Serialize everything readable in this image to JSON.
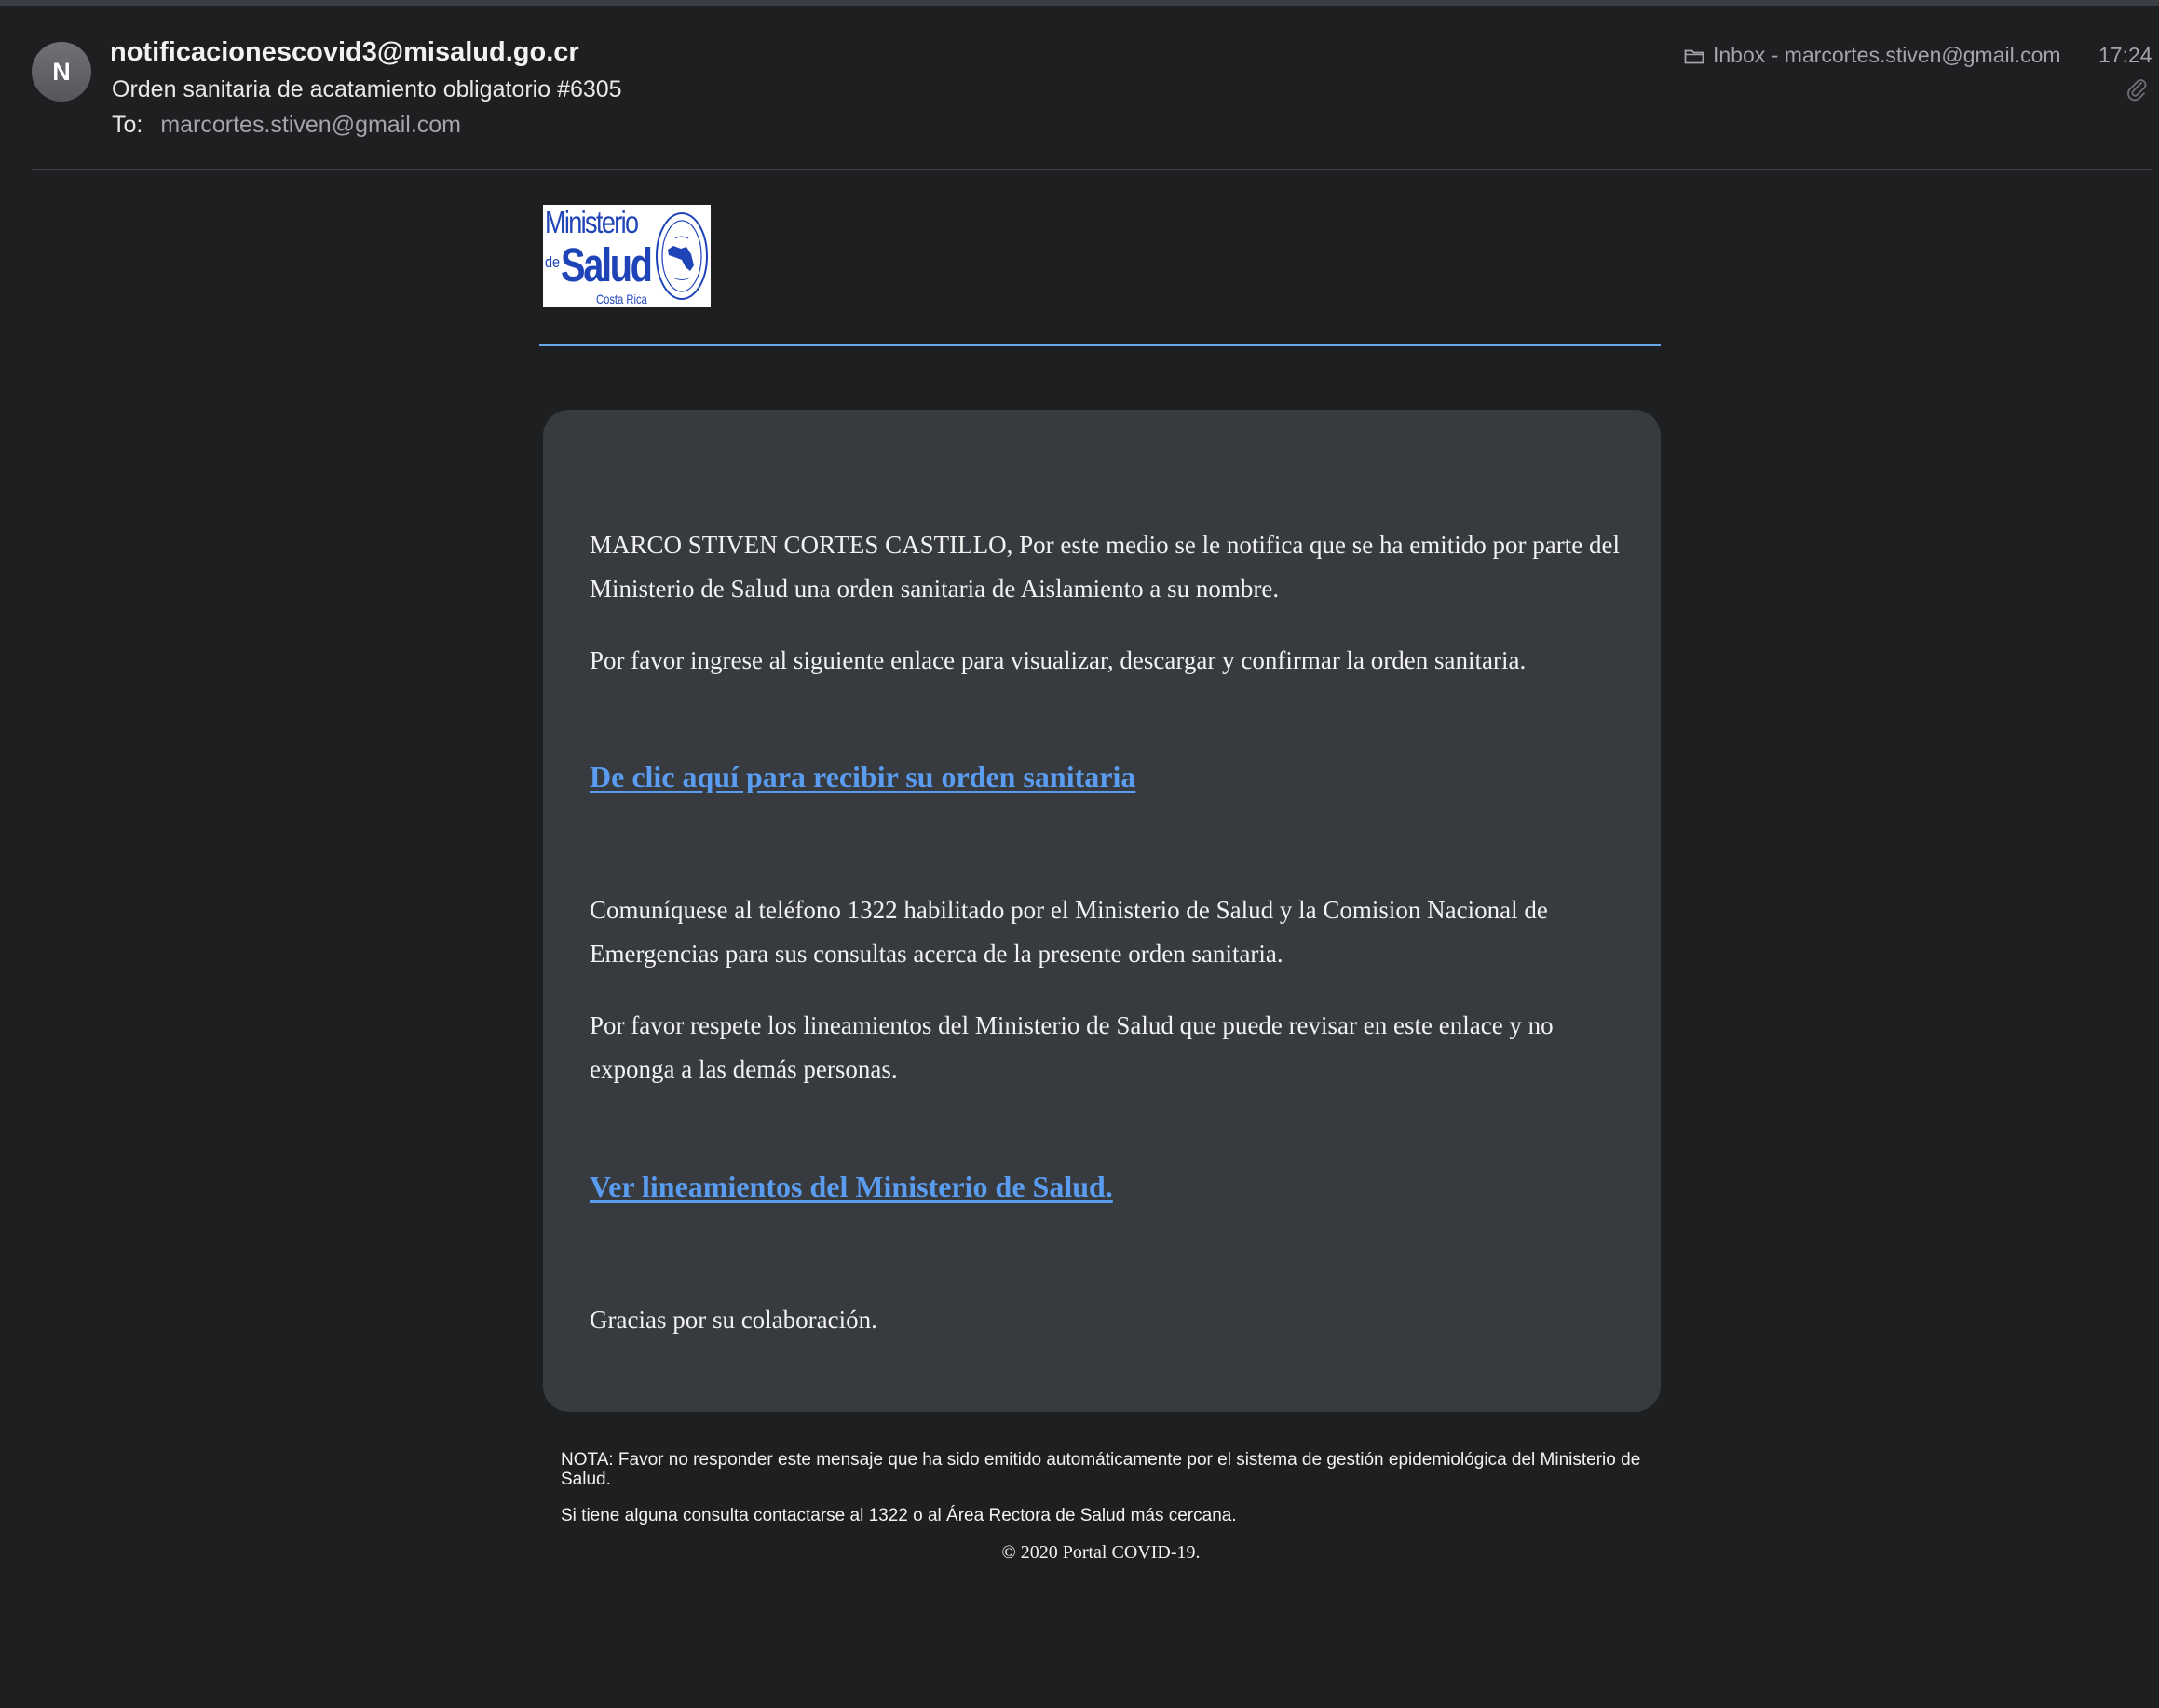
{
  "header": {
    "avatar_initial": "N",
    "from": "notificacionescovid3@misalud.go.cr",
    "subject": "Orden sanitaria de acatamiento obligatorio #6305",
    "to_label": "To:",
    "to_value": "marcortes.stiven@gmail.com",
    "mailbox": "Inbox - marcortes.stiven@gmail.com",
    "time": "17:24",
    "icons": [
      "folder-icon",
      "paperclip-icon"
    ]
  },
  "logo": {
    "line1": "Ministerio",
    "de": "de",
    "line2": "Salud",
    "country": "Costa Rica"
  },
  "body": {
    "para1": "MARCO STIVEN CORTES CASTILLO, Por este medio se le notifica que se ha emitido por parte del Ministerio de Salud una orden sanitaria de Aislamiento a su nombre.",
    "para2": "Por favor ingrese al siguiente enlace para visualizar, descargar y confirmar la orden sanitaria.",
    "link1": "De clic aquí para recibir su orden sanitaria",
    "para3": "Comuníquese al teléfono 1322 habilitado por el Ministerio de Salud y la Comision Nacional de Emergencias para sus consultas acerca de la presente orden sanitaria.",
    "para4": "Por favor respete los lineamientos del Ministerio de Salud que puede revisar en este enlace y no exponga a las demás personas.",
    "link2": "Ver lineamientos del Ministerio de Salud.",
    "closing": "Gracias por su colaboración."
  },
  "footer": {
    "note": "NOTA: Favor no responder este mensaje que ha sido emitido automáticamente por el sistema de gestión epidemiológica del Ministerio de Salud.",
    "contact": "Si tiene alguna consulta contactarse al 1322 o al Área Rectora de Salud más cercana.",
    "copyright": "© 2020 Portal COVID-19."
  },
  "colors": {
    "background": "#1e1f21",
    "card": "#373a3f",
    "link": "#5a9cf0",
    "rule": "#6aa7ea",
    "logo_blue": "#1f44b8"
  }
}
